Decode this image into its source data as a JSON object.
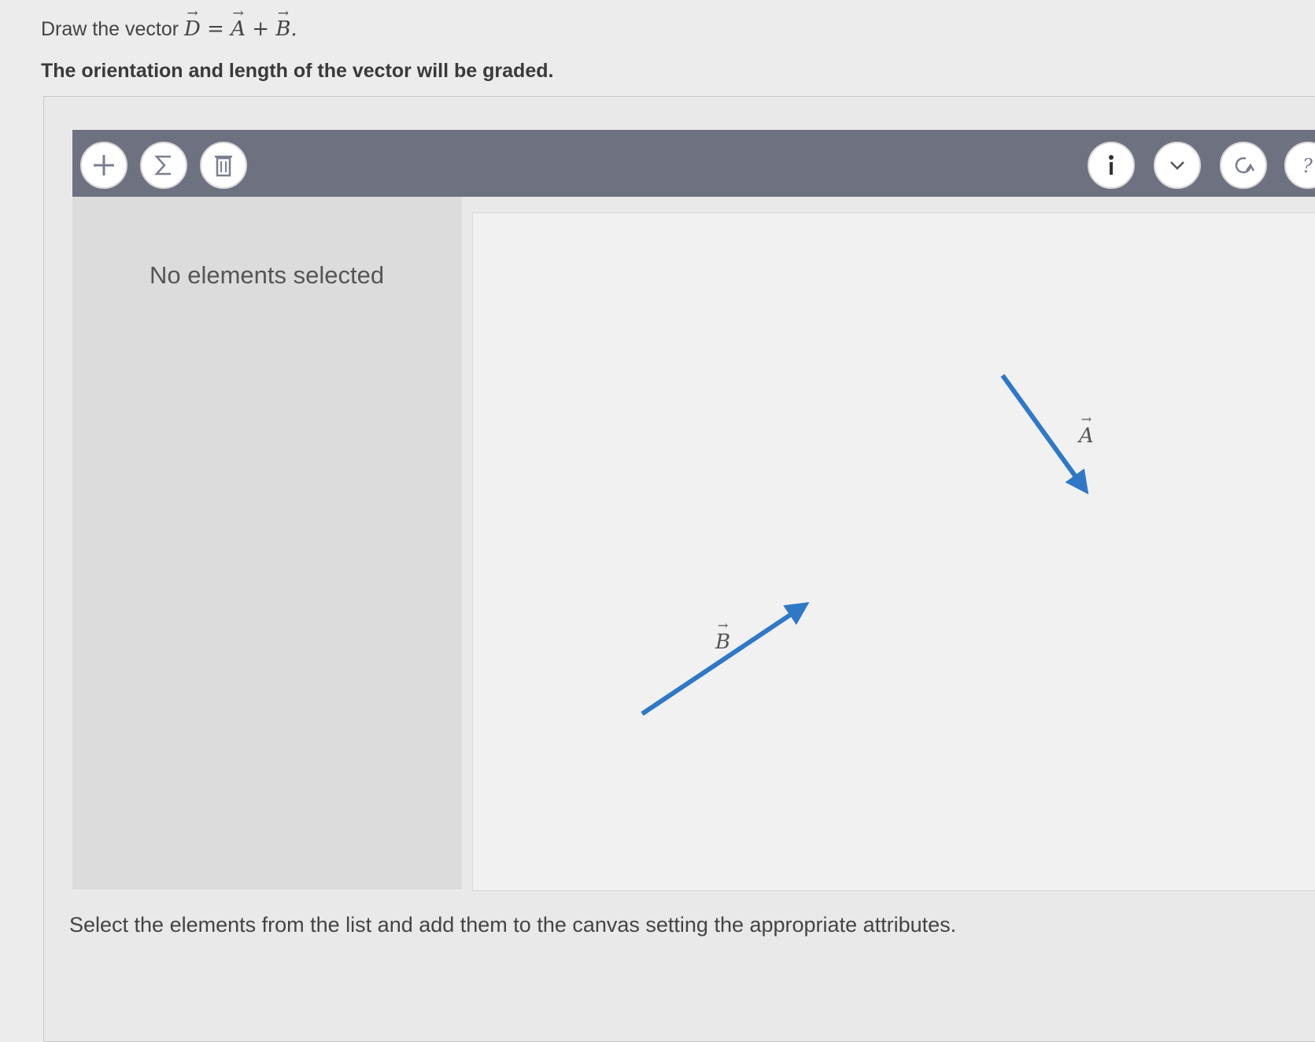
{
  "prompt": {
    "prefix": "Draw the vector ",
    "d": "D",
    "eq": " = ",
    "a": "A",
    "plus": " + ",
    "b": "B",
    "end": "."
  },
  "instruction": "The orientation and length of the vector will be graded.",
  "toolbar": {
    "left_buttons": [
      {
        "name": "add-button",
        "icon": "plus-icon"
      },
      {
        "name": "sum-button",
        "icon": "sigma-icon"
      },
      {
        "name": "delete-button",
        "icon": "trash-icon"
      }
    ],
    "right_buttons": [
      {
        "name": "info-button",
        "icon": "info-icon"
      },
      {
        "name": "collapse-button",
        "icon": "chevron-down-icon"
      },
      {
        "name": "reset-button",
        "icon": "refresh-icon"
      },
      {
        "name": "help-button",
        "icon": "help-icon"
      }
    ]
  },
  "side_panel": {
    "message": "No elements selected"
  },
  "canvas": {
    "vectors": [
      {
        "label": "A",
        "color": "#2e78c7"
      },
      {
        "label": "B",
        "color": "#2e78c7"
      }
    ]
  },
  "footer": "Select the elements from the list and add them to the canvas setting the appropriate attributes."
}
